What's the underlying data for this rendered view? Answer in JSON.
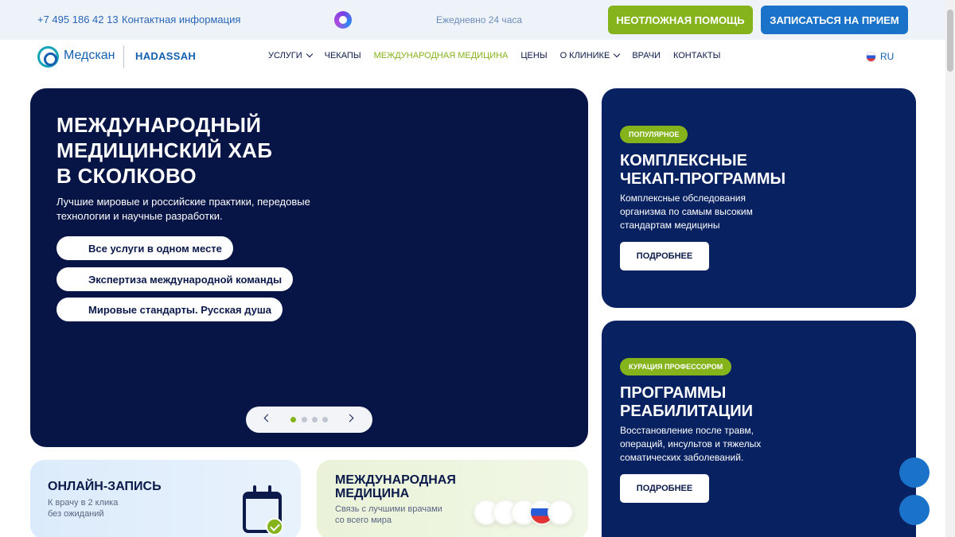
{
  "topbar": {
    "phone": "+7 495 186 42 13",
    "contact_link": "Контактная информация",
    "hours": "Ежедневно 24 часа",
    "urgent_button": "НЕОТЛОЖНАЯ ПОМОЩЬ",
    "book_button": "ЗАПИСАТЬСЯ НА ПРИЕМ",
    "colors": {
      "urgent": "#85b31c",
      "book": "#1a73c8"
    }
  },
  "brand": {
    "name": "Медскан",
    "partner": "HADASSAH"
  },
  "nav": {
    "items": [
      {
        "label": "УСЛУГИ",
        "dropdown": true
      },
      {
        "label": "ЧЕКАПЫ",
        "dropdown": false
      },
      {
        "label": "МЕЖДУНАРОДНАЯ МЕДИЦИНА",
        "dropdown": false,
        "active": true
      },
      {
        "label": "ЦЕНЫ",
        "dropdown": false
      },
      {
        "label": "О КЛИНИКЕ",
        "dropdown": true
      },
      {
        "label": "ВРАЧИ",
        "dropdown": false
      },
      {
        "label": "КОНТАКТЫ",
        "dropdown": false
      }
    ],
    "language": "RU"
  },
  "hero": {
    "title_lines": [
      "МЕЖДУНАРОДНЫЙ",
      "МЕДИЦИНСКИЙ ХАБ",
      "В СКОЛКОВО"
    ],
    "subtitle": "Лучшие мировые и российские практики, передовые технологии и научные разработки.",
    "chips": [
      "Все услуги в одном месте",
      "Экспертиза международной команды",
      "Мировые стандарты. Русская душа"
    ],
    "slider": {
      "total": 4,
      "active": 1
    }
  },
  "cards": [
    {
      "tag": "ПОПУЛЯРНОЕ",
      "title_lines": [
        "КОМПЛЕКСНЫЕ",
        "ЧЕКАП-ПРОГРАММЫ"
      ],
      "text": "Комплексные обследования организма по самым высоким стандартам медицины",
      "button": "ПОДРОБНЕЕ"
    },
    {
      "tag": "КУРАЦИЯ ПРОФЕССОРОМ",
      "title_lines": [
        "ПРОГРАММЫ",
        "РЕАБИЛИТАЦИИ"
      ],
      "text": "Восстановление после травм, операций, инсультов и тяжелых соматических заболеваний.",
      "button": "ПОДРОБНЕЕ"
    }
  ],
  "bottom_cards": [
    {
      "title_lines": [
        "ОНЛАЙН-ЗАПИСЬ"
      ],
      "text_lines": [
        "К врачу в 2 клика",
        "без ожиданий"
      ]
    },
    {
      "title_lines": [
        "МЕЖДУНАРОДНАЯ",
        "МЕДИЦИНА"
      ],
      "text_lines": [
        "Связь с лучшими врачами",
        "со всего мира"
      ]
    }
  ]
}
